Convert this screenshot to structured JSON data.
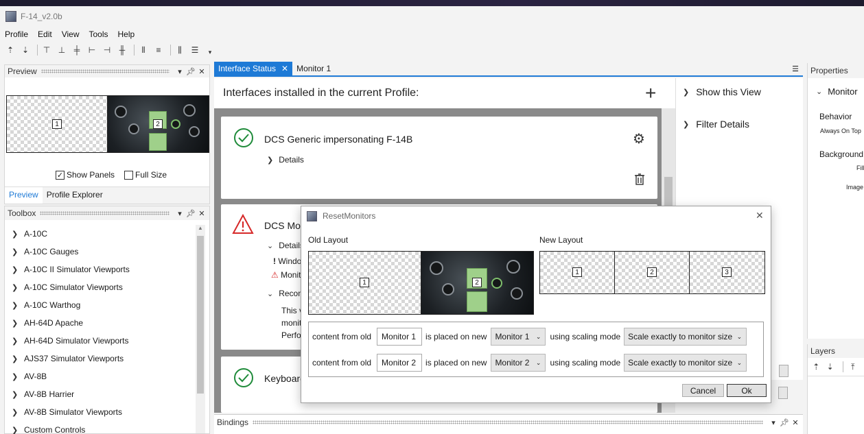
{
  "window": {
    "title": "F-14_v2.0b"
  },
  "menu": [
    "Profile",
    "Edit",
    "View",
    "Tools",
    "Help"
  ],
  "preview_panel": {
    "title": "Preview",
    "monitor_labels": [
      "1",
      "2"
    ],
    "show_panels_label": "Show Panels",
    "show_panels_checked": true,
    "full_size_label": "Full Size",
    "full_size_checked": false,
    "tabs": [
      "Preview",
      "Profile Explorer"
    ]
  },
  "toolbox": {
    "title": "Toolbox",
    "items": [
      "A-10C",
      "A-10C Gauges",
      "A-10C II Simulator Viewports",
      "A-10C Simulator Viewports",
      "A-10C Warthog",
      "AH-64D Apache",
      "AH-64D Simulator Viewports",
      "AJS37 Simulator Viewports",
      "AV-8B",
      "AV-8B Harrier",
      "AV-8B Simulator Viewports",
      "Custom Controls"
    ]
  },
  "doc_tabs": [
    "Interface Status",
    "Monitor 1"
  ],
  "interface_status": {
    "heading": "Interfaces installed in the current Profile:",
    "cards": [
      {
        "title": "DCS Generic impersonating F-14B",
        "details_label": "Details"
      },
      {
        "title": "DCS Mon",
        "details_label": "Details",
        "line1": "Windo",
        "line2": "Monit",
        "recommend": "Recom",
        "body1": "This v",
        "body2": "monit",
        "body3": "Perfo"
      },
      {
        "title": "Keyboard"
      }
    ],
    "side_actions": [
      "Show this View",
      "Filter Details"
    ]
  },
  "properties": {
    "title": "Properties",
    "section": "Monitor",
    "behavior": "Behavior",
    "always_on_top": "Always On Top",
    "background": "Background",
    "fill": "Fill",
    "image": "Image"
  },
  "layers": {
    "title": "Layers"
  },
  "bindings": {
    "title": "Bindings"
  },
  "dialog": {
    "title": "ResetMonitors",
    "old_layout_label": "Old Layout",
    "new_layout_label": "New Layout",
    "old_monitors": [
      "1",
      "2"
    ],
    "new_monitors": [
      "1",
      "2",
      "3"
    ],
    "rows": [
      {
        "prefix": "content from old",
        "source": "Monitor 1",
        "middle": "is placed on new",
        "target": "Monitor 1",
        "mode_label": "using scaling mode",
        "mode": "Scale exactly to monitor size"
      },
      {
        "prefix": "content from old",
        "source": "Monitor 2",
        "middle": "is placed on new",
        "target": "Monitor 2",
        "mode_label": "using scaling mode",
        "mode": "Scale exactly to monitor size"
      }
    ],
    "cancel_label": "Cancel",
    "ok_label": "Ok"
  },
  "colors": {
    "accent": "#1e7ad6",
    "success": "#1f8b3a",
    "warning": "#d62828"
  }
}
